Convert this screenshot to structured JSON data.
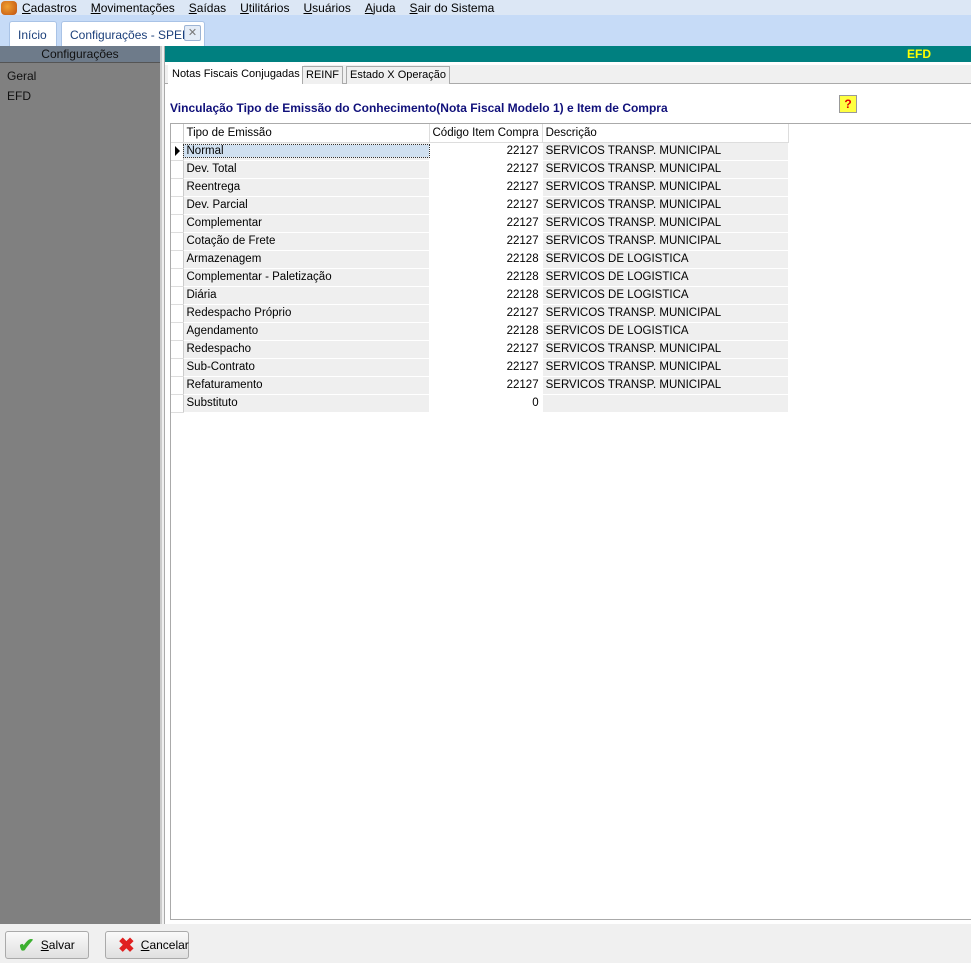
{
  "menu": [
    "Cadastros",
    "Movimentações",
    "Saídas",
    "Utilitários",
    "Usuários",
    "Ajuda",
    "Sair do Sistema"
  ],
  "doc_tabs": [
    "Início",
    "Configurações - SPED"
  ],
  "sidebar": {
    "header": "Configurações",
    "items": [
      "Geral",
      "EFD"
    ]
  },
  "panel": {
    "header": "EFD",
    "tabs": [
      "Notas Fiscais Conjugadas",
      "REINF",
      "Estado X Operação"
    ],
    "title": "Vinculação Tipo de Emissão do Conhecimento(Nota Fiscal Modelo  1)  e  Item de Compra",
    "help": "?"
  },
  "grid": {
    "columns": [
      "Tipo de Emissão",
      "Código Item Compra",
      "Descrição"
    ],
    "rows": [
      [
        "Normal",
        "22127",
        "SERVICOS TRANSP. MUNICIPAL"
      ],
      [
        "Dev. Total",
        "22127",
        "SERVICOS TRANSP. MUNICIPAL"
      ],
      [
        "Reentrega",
        "22127",
        "SERVICOS TRANSP. MUNICIPAL"
      ],
      [
        "Dev. Parcial",
        "22127",
        "SERVICOS TRANSP. MUNICIPAL"
      ],
      [
        "Complementar",
        "22127",
        "SERVICOS TRANSP. MUNICIPAL"
      ],
      [
        "Cotação de Frete",
        "22127",
        "SERVICOS TRANSP. MUNICIPAL"
      ],
      [
        "Armazenagem",
        "22128",
        "SERVICOS DE LOGISTICA"
      ],
      [
        "Complementar - Paletização",
        "22128",
        "SERVICOS DE LOGISTICA"
      ],
      [
        "Diária",
        "22128",
        "SERVICOS DE LOGISTICA"
      ],
      [
        "Redespacho Próprio",
        "22127",
        "SERVICOS TRANSP. MUNICIPAL"
      ],
      [
        "Agendamento",
        "22128",
        "SERVICOS DE LOGISTICA"
      ],
      [
        "Redespacho",
        "22127",
        "SERVICOS TRANSP. MUNICIPAL"
      ],
      [
        "Sub-Contrato",
        "22127",
        "SERVICOS TRANSP. MUNICIPAL"
      ],
      [
        "Refaturamento",
        "22127",
        "SERVICOS TRANSP. MUNICIPAL"
      ],
      [
        "Substituto",
        "0",
        ""
      ]
    ]
  },
  "buttons": {
    "save": "Salvar",
    "cancel": "Cancelar"
  }
}
